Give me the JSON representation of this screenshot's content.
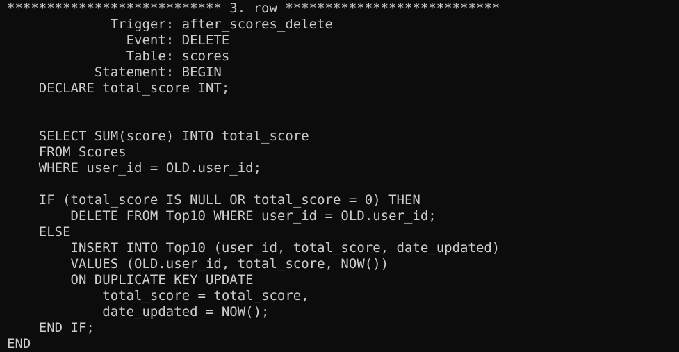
{
  "terminal": {
    "lines": [
      "*************************** 3. row ***************************",
      "             Trigger: after_scores_delete",
      "               Event: DELETE",
      "               Table: scores",
      "           Statement: BEGIN",
      "    DECLARE total_score INT;",
      "",
      "",
      "    SELECT SUM(score) INTO total_score",
      "    FROM Scores",
      "    WHERE user_id = OLD.user_id;",
      "",
      "    IF (total_score IS NULL OR total_score = 0) THEN",
      "        DELETE FROM Top10 WHERE user_id = OLD.user_id;",
      "    ELSE",
      "        INSERT INTO Top10 (user_id, total_score, date_updated)",
      "        VALUES (OLD.user_id, total_score, NOW())",
      "        ON DUPLICATE KEY UPDATE",
      "            total_score = total_score,",
      "            date_updated = NOW();",
      "    END IF;",
      "END"
    ],
    "colors": {
      "background": "#0c0c0c",
      "foreground": "#cccccc"
    }
  }
}
